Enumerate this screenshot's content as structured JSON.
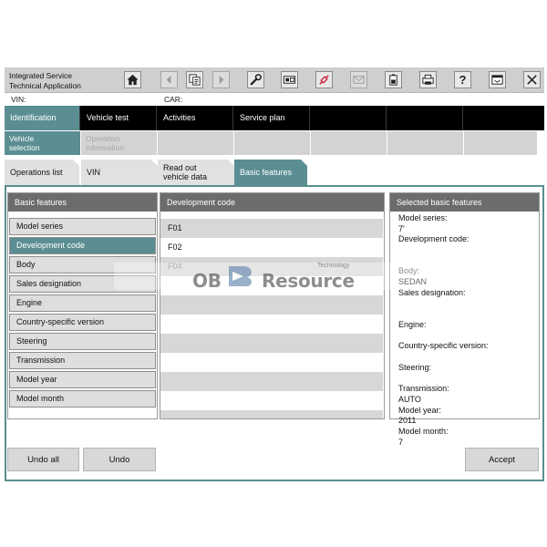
{
  "app": {
    "title_line1": "Integrated Service",
    "title_line2": "Technical Application"
  },
  "toolbar": {
    "icons": [
      "home-icon",
      "back-icon",
      "copy-icon",
      "forward-icon",
      "wrench-icon",
      "connection-icon",
      "plug-icon",
      "mail-icon",
      "battery-icon",
      "print-icon",
      "help-icon",
      "window-icon",
      "close-icon"
    ],
    "help_glyph": "?"
  },
  "vehicle": {
    "vin_label": "VIN:",
    "car_label": "CAR:"
  },
  "main_nav": [
    {
      "label": "Identification",
      "active": true
    },
    {
      "label": "Vehicle test",
      "active": false
    },
    {
      "label": "Activities",
      "active": false
    },
    {
      "label": "Service plan",
      "active": false
    },
    {
      "label": "",
      "active": false
    },
    {
      "label": "",
      "active": false
    },
    {
      "label": "",
      "active": false
    }
  ],
  "sub_nav": {
    "vehicle_selection": {
      "line1": "Vehicle",
      "line2": "selection"
    },
    "operation_information": {
      "line1": "Operation",
      "line2": "information"
    }
  },
  "tabs": {
    "operations_list": "Operations list",
    "vin": "VIN",
    "read_out_line1": "Read out",
    "read_out_line2": "vehicle data",
    "basic_features": "Basic features"
  },
  "basic_features_panel": {
    "title": "Basic features",
    "items": [
      "Model series",
      "Development code",
      "Body",
      "Sales designation",
      "Engine",
      "Country-specific version",
      "Steering",
      "Transmission",
      "Model year",
      "Model month"
    ],
    "active_index": 1
  },
  "development_code_panel": {
    "title": "Development code",
    "codes": [
      "F01",
      "F02",
      "F04"
    ]
  },
  "selected_panel": {
    "title": "Selected basic features",
    "model_series_label": "Model series:",
    "model_series_value": "7'",
    "development_code_label": "Development code:",
    "body_label": "Body:",
    "body_value": "SEDAN",
    "sales_designation_label": "Sales designation:",
    "engine_label": "Engine:",
    "country_label": "Country-specific version:",
    "steering_label": "Steering:",
    "transmission_label": "Transmission:",
    "transmission_value": "AUTO",
    "model_year_label": "Model year:",
    "model_year_value": "2011",
    "model_month_label": "Model month:",
    "model_month_value": "7"
  },
  "buttons": {
    "undo_all": "Undo all",
    "undo": "Undo",
    "accept": "Accept"
  },
  "watermark": {
    "part1": "OB",
    "part2": "Resource",
    "small": "Technology"
  },
  "colors": {
    "accent": "#5b8e92",
    "nav_bg": "#000000",
    "panel_header": "#6c6c6c"
  }
}
